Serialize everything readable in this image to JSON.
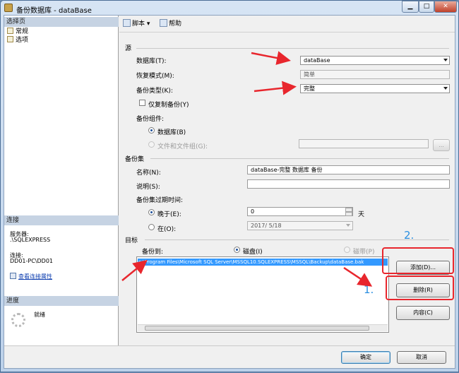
{
  "window": {
    "title": "备份数据库 - dataBase",
    "min_label": "▁",
    "max_label": "□",
    "close_label": "✕"
  },
  "left_panel": {
    "select_page_header": "选择页",
    "pages": [
      {
        "label": "常规"
      },
      {
        "label": "选项"
      }
    ],
    "connection_header": "连接",
    "server_label": "服务器:",
    "server_value": ".\\SQLEXPRESS",
    "connection_label": "连接:",
    "connection_value": "DD01-PC\\DD01",
    "view_props_link": "查看连接属性",
    "progress_header": "进度",
    "progress_status": "就绪"
  },
  "toolbar": {
    "script_label": "脚本 ▾",
    "help_label": "帮助"
  },
  "source": {
    "header": "源",
    "database_label": "数据库(T):",
    "database_value": "dataBase",
    "recovery_label": "恢复模式(M):",
    "recovery_value": "简单",
    "backup_type_label": "备份类型(K):",
    "backup_type_value": "完整",
    "copy_only_label": "仅复制备份(Y)",
    "component_label": "备份组件:",
    "component_db_label": "数据库(B)",
    "component_files_label": "文件和文件组(G):",
    "browse_label": "..."
  },
  "backup_set": {
    "header": "备份集",
    "name_label": "名称(N):",
    "name_value": "dataBase-完整 数据库 备份",
    "desc_label": "说明(S):",
    "desc_value": "",
    "expire_label": "备份集过期时间:",
    "after_label": "晚于(E):",
    "after_value": "0",
    "days_label": "天",
    "on_label": "在(O):",
    "on_value": "2017/ 5/18"
  },
  "destination": {
    "header": "目标",
    "backup_to_label": "备份到:",
    "disk_label": "磁盘(I)",
    "tape_label": "磁带(P)",
    "paths": [
      "c:\\Program Files\\Microsoft SQL Server\\MSSQL10.SQLEXPRESS\\MSSQL\\Backup\\dataBase.bak"
    ],
    "add_label": "添加(D)...",
    "remove_label": "删除(R)",
    "contents_label": "内容(C)"
  },
  "footer": {
    "ok_label": "确定",
    "cancel_label": "取消"
  },
  "annotations": {
    "step1": "1.",
    "step2": "2.",
    "color": "#e8262d"
  }
}
